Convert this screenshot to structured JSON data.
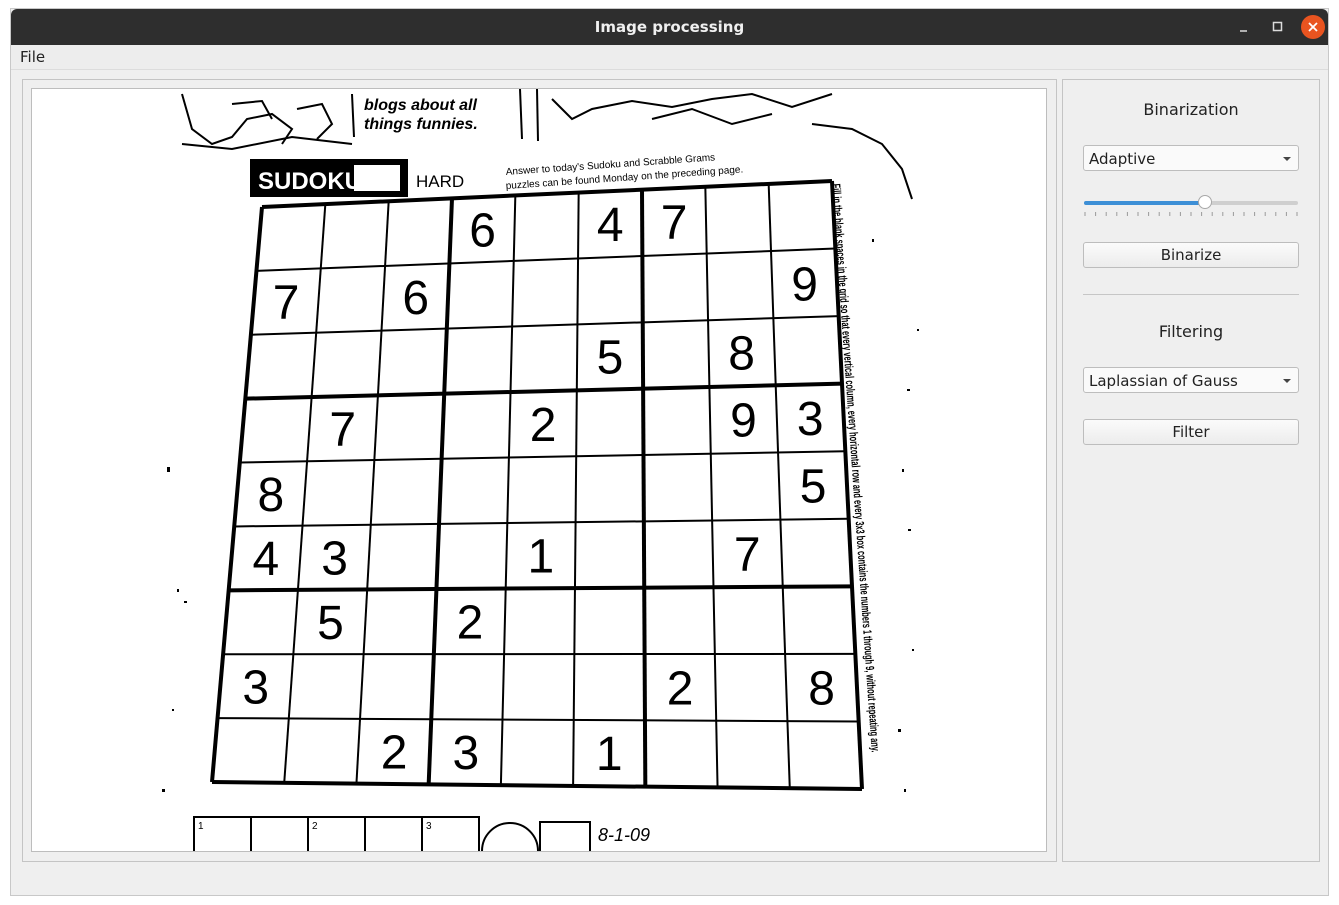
{
  "window": {
    "title": "Image processing"
  },
  "menubar": {
    "file_label": "File"
  },
  "image": {
    "header_left": "blogs about all",
    "header_right": "things funnies.",
    "sudoku_label": "SUDOKU",
    "difficulty": "HARD",
    "answer_line1": "Answer to today's Sudoku and Scrabble Grams",
    "answer_line2": "puzzles can be found Monday on the preceding page.",
    "instructions": "Fill in the blank spaces in the grid so that every vertical column, every horizontal row and every 3x3 box contains the numbers 1 through 9, without repeating any.",
    "date": "8-1-09",
    "footer_numbers": [
      "1",
      "2",
      "3"
    ],
    "grid": [
      [
        "",
        "",
        "",
        "6",
        "",
        "4",
        "7",
        "",
        ""
      ],
      [
        "7",
        "",
        "6",
        "",
        "",
        "",
        "",
        "",
        "9"
      ],
      [
        "",
        "",
        "",
        "",
        "",
        "5",
        "",
        "8",
        ""
      ],
      [
        "",
        "7",
        "",
        "",
        "2",
        "",
        "",
        "9",
        "3"
      ],
      [
        "8",
        "",
        "",
        "",
        "",
        "",
        "",
        "",
        "5"
      ],
      [
        "4",
        "3",
        "",
        "",
        "1",
        "",
        "",
        "7",
        ""
      ],
      [
        "",
        "5",
        "",
        "2",
        "",
        "",
        "",
        "",
        ""
      ],
      [
        "3",
        "",
        "",
        "",
        "",
        "",
        "2",
        "",
        "8"
      ],
      [
        "",
        "",
        "2",
        "3",
        "",
        "1",
        "",
        "",
        ""
      ]
    ]
  },
  "binarization": {
    "title": "Binarization",
    "method": "Adaptive",
    "slider_fraction": 0.565,
    "button_label": "Binarize"
  },
  "filtering": {
    "title": "Filtering",
    "method": "Laplassian of Gauss",
    "button_label": "Filter"
  },
  "colors": {
    "titlebar": "#2e2e2e",
    "close_button": "#e95420",
    "slider_fill": "#3d8fd6"
  }
}
